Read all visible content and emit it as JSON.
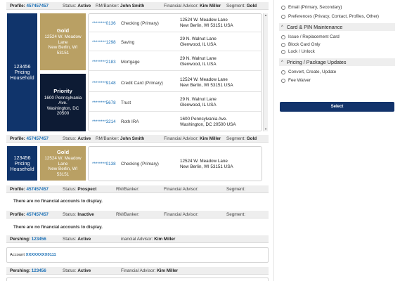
{
  "labels": {
    "profile": "Profile:",
    "status": "Status:",
    "rm_banker": "RM/Banker:",
    "financial_advisor": "Financial Advisor:",
    "segment": "Segment:",
    "pershing": "Pershing:",
    "account": "Account",
    "no_accounts": "There are no financial accounts to display."
  },
  "profiles": [
    {
      "profile_id": "457457457",
      "status": "Active",
      "rm_banker": "John Smith",
      "advisor": "Kim Miller",
      "segment": "Gold",
      "household": "123456\nPricing\nHousehold",
      "groups": [
        {
          "tier": "Gold",
          "address": "12524 W. Meadow\nLane\nNew Berlin, WI\n53151",
          "accounts": [
            {
              "number": "********0136",
              "type": "Checking (Primary)",
              "address1": "12524 W. Meadow Lane",
              "address2": "New Berlin, WI 53151 USA"
            },
            {
              "number": "********1298",
              "type": "Saving",
              "address1": "29 N. Walnut Lane",
              "address2": "Glenwood, IL USA"
            },
            {
              "number": "********2183",
              "type": "Mortgage",
              "address1": "29 N. Walnut Lane",
              "address2": "Glenwood, IL USA"
            }
          ]
        },
        {
          "tier": "Priority",
          "address": "1600 Pennsylvania\nAve.\nWashington, DC\n20500",
          "accounts": [
            {
              "number": "********9148",
              "type": "Credit Card (Primary)",
              "address1": "12524 W. Meadow Lane",
              "address2": "New Berlin, WI 53151 USA"
            },
            {
              "number": "********5678",
              "type": "Trust",
              "address1": "29 N. Walnut Lane",
              "address2": "Glenwood, IL USA"
            },
            {
              "number": "********3214",
              "type": "Roth IRA",
              "address1": "1600 Pennsylvania Ave.",
              "address2": "Washington, DC 20500 USA"
            }
          ]
        }
      ]
    },
    {
      "profile_id": "457457457",
      "status": "Active",
      "rm_banker": "John Smith",
      "advisor": "Kim Miller",
      "segment": "Gold",
      "household": "123456\nPricing\nHousehold",
      "groups": [
        {
          "tier": "Gold",
          "address": "12524 W. Meadow\nLane\nNew Berlin, WI\n53151",
          "accounts": [
            {
              "number": "********0138",
              "type": "Checking (Primary)",
              "address1": "12524 W. Meadow Lane",
              "address2": "New Berlin, WI 53151 USA"
            }
          ]
        }
      ]
    },
    {
      "profile_id": "457457457",
      "status": "Prospect",
      "rm_banker": "",
      "advisor": "",
      "segment": ""
    },
    {
      "profile_id": "457457457",
      "status": "Inactive",
      "rm_banker": "",
      "advisor": "",
      "segment": ""
    }
  ],
  "pershing": [
    {
      "id": "123456",
      "status": "Active",
      "advisor_label": "inancial Advisor:",
      "advisor": "Kim Miller",
      "account": "XXXXXXXX0111"
    },
    {
      "id": "123456",
      "status": "Active",
      "advisor_label": "Financial Advisor:",
      "advisor": "Kim Miller"
    }
  ],
  "right_panel": {
    "top_options": [
      "Email (Primary, Secondary)",
      "Preferences (Privacy, Contact, Profiles, Other)"
    ],
    "sections": [
      {
        "title": "Card & PIN Maintenance",
        "options": [
          "Issue / Replacement Card",
          "Block Card Only",
          "Lock / Unlock"
        ]
      },
      {
        "title": "Pricing / Package Updates",
        "options": [
          "Convert, Create, Update",
          "Fee Waiver"
        ]
      }
    ],
    "select_label": "Select",
    "chevron": "^"
  },
  "scroll": {
    "up": "▲",
    "down": "▼"
  },
  "colors": {
    "navy": "#10346b",
    "gold": "#b9a064",
    "priority": "#0d1b34",
    "link": "#1a6fb5",
    "select_button": "#12336b"
  }
}
